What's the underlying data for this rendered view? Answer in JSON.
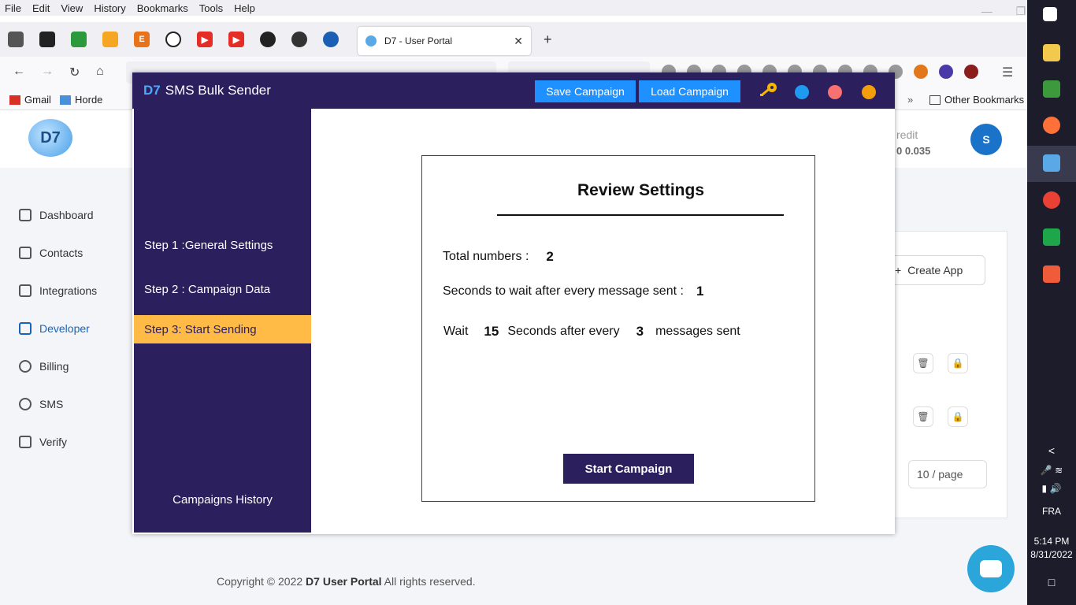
{
  "browser": {
    "menu": [
      "File",
      "Edit",
      "View",
      "History",
      "Bookmarks",
      "Tools",
      "Help"
    ],
    "tab_title": "D7 - User Portal",
    "bookmarks": [
      "Gmail",
      "Horde"
    ],
    "other_bookmarks": "Other Bookmarks"
  },
  "portal": {
    "logo_text": "D7",
    "credit_label": "redit",
    "credit_value": "0 0.035",
    "avatar_letter": "S",
    "nav": [
      "Dashboard",
      "Contacts",
      "Integrations",
      "Developer",
      "Billing",
      "SMS",
      "Verify"
    ],
    "create_app": "Create App",
    "page_size": "10 / page",
    "footer_prefix": "Copyright © 2022",
    "footer_brand": "D7 User Portal",
    "footer_suffix": "All rights reserved."
  },
  "taskbar": {
    "lang": "FRA",
    "time": "5:14 PM",
    "date": "8/31/2022"
  },
  "app": {
    "brand": "D7",
    "title": "SMS Bulk Sender",
    "save_campaign": "Save Campaign",
    "load_campaign": "Load Campaign",
    "dot_colors": [
      "#1e9bf0",
      "#f87171",
      "#f59e0b"
    ],
    "steps": [
      {
        "label": "Step 1 :General Settings"
      },
      {
        "label": "Step 2 : Campaign Data"
      },
      {
        "label": "Step 3: Start Sending"
      }
    ],
    "campaigns_history": "Campaigns History",
    "review": {
      "title": "Review Settings",
      "total_label": "Total numbers :",
      "total_value": "2",
      "wait_label": "Seconds to wait after every message sent :",
      "wait_value": "1",
      "batch_wait_prefix": "Wait",
      "batch_wait_seconds": "15",
      "batch_wait_middle": "Seconds after every",
      "batch_count": "3",
      "batch_wait_suffix": "messages sent",
      "start_button": "Start Campaign"
    }
  }
}
